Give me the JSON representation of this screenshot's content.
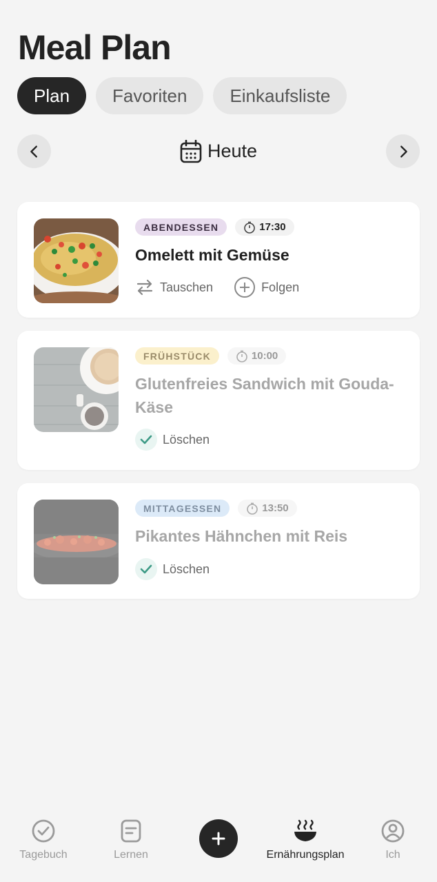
{
  "page": {
    "title": "Meal Plan"
  },
  "tabs": [
    {
      "label": "Plan",
      "active": true
    },
    {
      "label": "Favoriten",
      "active": false
    },
    {
      "label": "Einkaufsliste",
      "active": false
    }
  ],
  "date_nav": {
    "label": "Heute",
    "icon": "calendar-icon"
  },
  "meals": [
    {
      "category": "ABENDESSEN",
      "time": "17:30",
      "title": "Omelett mit Gemüse",
      "actions": [
        "Tauschen",
        "Folgen"
      ],
      "done": false
    },
    {
      "category": "FRÜHSTÜCK",
      "time": "10:00",
      "title": "Glutenfreies Sandwich mit Gouda-Käse",
      "actions": [
        "Löschen"
      ],
      "done": true
    },
    {
      "category": "MITTAGESSEN",
      "time": "13:50",
      "title": "Pikantes Hähnchen mit Reis",
      "actions": [
        "Löschen"
      ],
      "done": true
    }
  ],
  "bottom_nav": [
    {
      "label": "Tagebuch",
      "icon": "check-circle-icon"
    },
    {
      "label": "Lernen",
      "icon": "document-icon"
    },
    {
      "label": "",
      "icon": "plus-icon"
    },
    {
      "label": "Ernährungsplan",
      "icon": "bowl-icon",
      "active": true
    },
    {
      "label": "Ich",
      "icon": "profile-icon"
    }
  ],
  "colors": {
    "accent_dark": "#262626",
    "badge_dinner": "#e8dcee",
    "badge_breakfast": "#fbf0cc",
    "badge_lunch": "#dceaf8",
    "check_green": "#3d9a86"
  }
}
